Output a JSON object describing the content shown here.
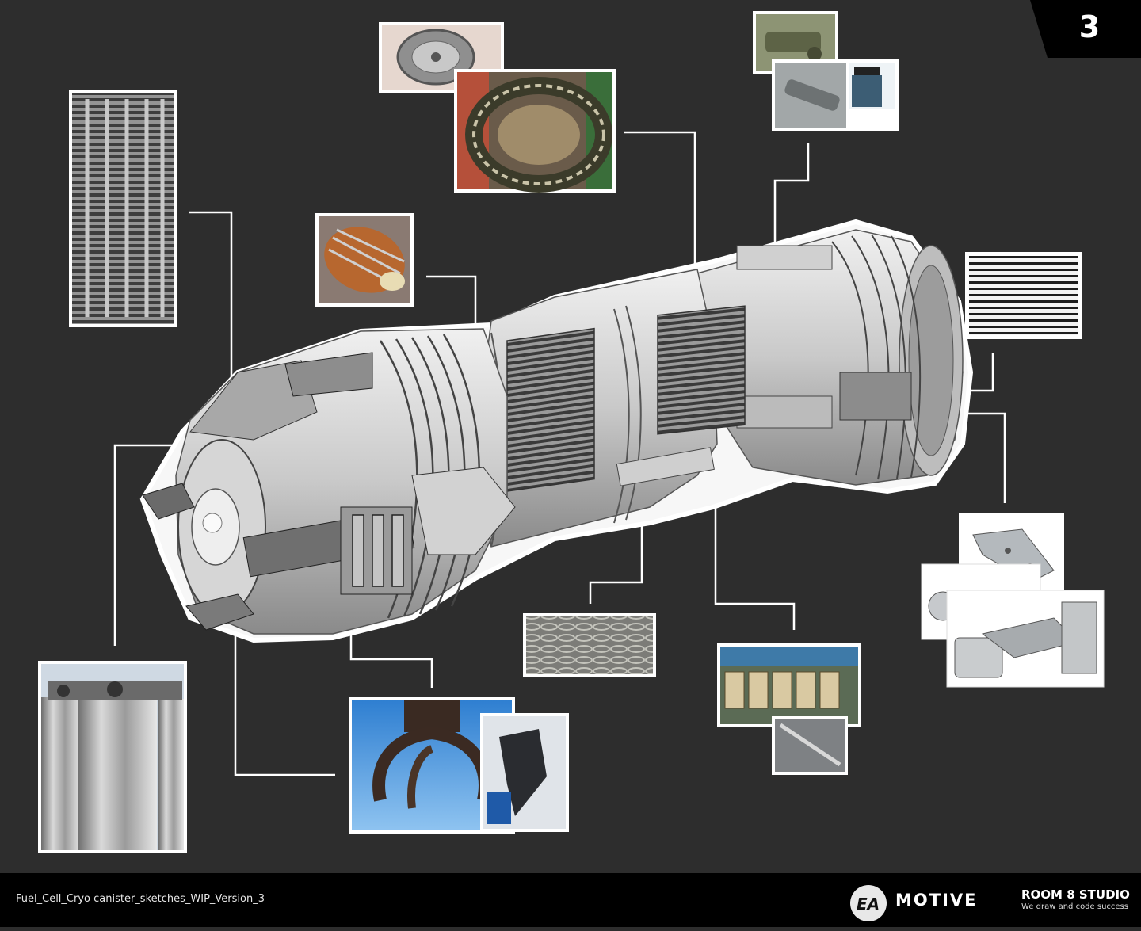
{
  "page": {
    "number": "3",
    "file_name": "Fuel_Cell_Cryo canister_sketches_WIP_Version_3"
  },
  "footer": {
    "ea_logo_text": "EA",
    "motive_logo_text": "MOTIVE",
    "studio_name": "ROOM 8 STUDIO",
    "studio_tagline": "We draw and code success"
  },
  "colors": {
    "background": "#2d2d2d",
    "footer": "#000000",
    "badge": "#000000",
    "callout_line": "#ffffff",
    "render_fill": "#d8d8d8",
    "render_dark": "#5a5a5a"
  },
  "reference_images": [
    {
      "name": "coil-radiator-photo",
      "icon": "coil-radiator"
    },
    {
      "name": "centrifuge-photo",
      "icon": "centrifuge"
    },
    {
      "name": "ring-stator-photo",
      "icon": "ring-stator"
    },
    {
      "name": "military-latch-photo",
      "icon": "latch"
    },
    {
      "name": "canister-clamp-photo",
      "icon": "clamp-canister"
    },
    {
      "name": "motor-stator-photo",
      "icon": "motor-stator"
    },
    {
      "name": "metal-grille-photo",
      "icon": "grille"
    },
    {
      "name": "hinge-photos",
      "icon": "hinges"
    },
    {
      "name": "cables-photo",
      "icon": "cables"
    },
    {
      "name": "industrial-machines-photo",
      "icon": "machinery"
    },
    {
      "name": "cryo-tanks-photo",
      "icon": "gas-cylinders"
    },
    {
      "name": "grapple-claw-photos",
      "icon": "grapple-claw"
    }
  ]
}
